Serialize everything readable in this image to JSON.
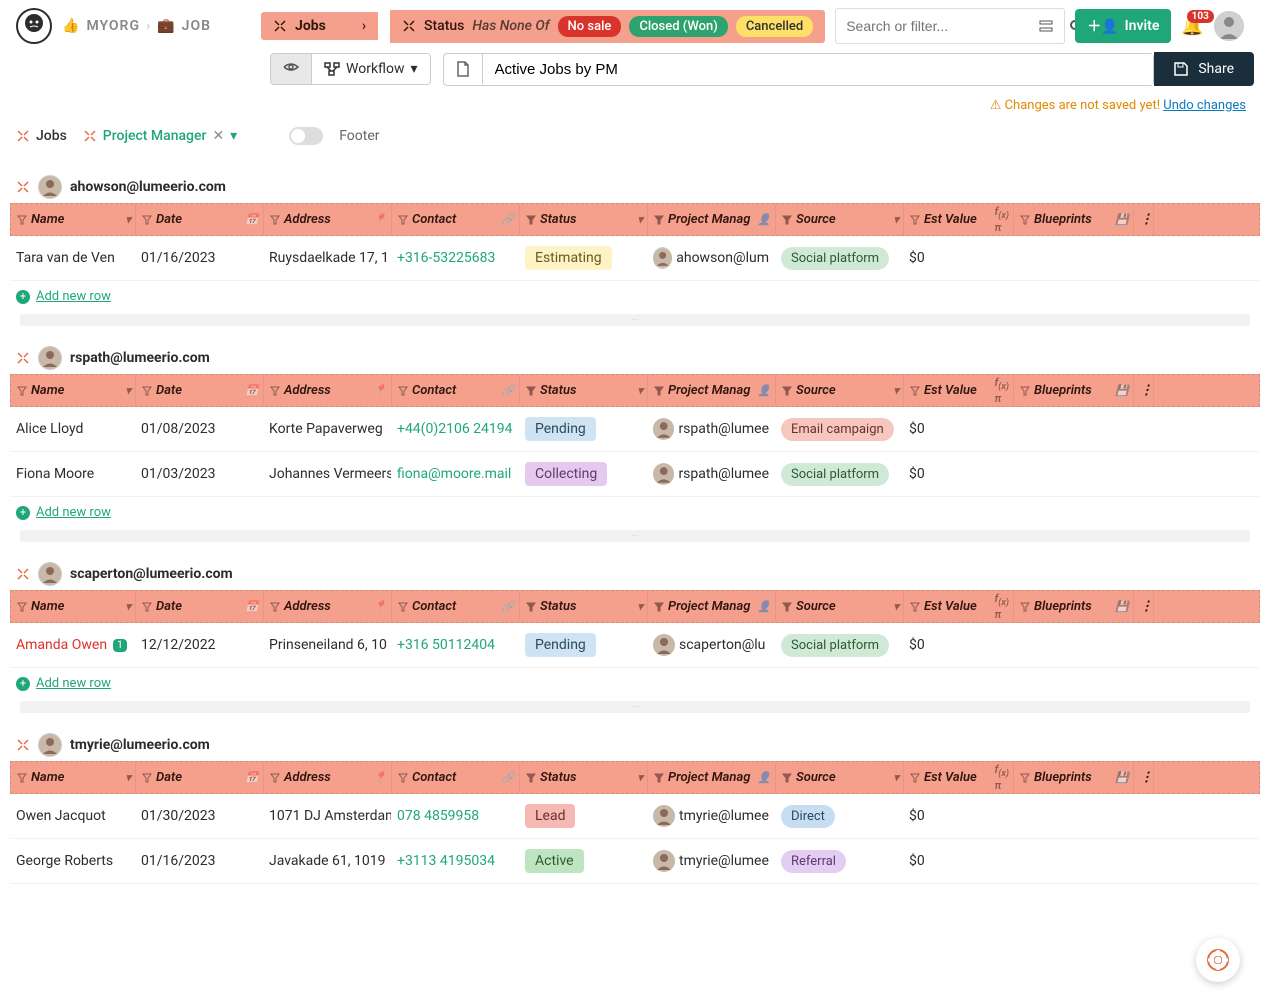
{
  "breadcrumb": {
    "org": "MYORG",
    "item": "JOB"
  },
  "filter": {
    "main": "Jobs",
    "status_label": "Status",
    "predicate": "Has None Of",
    "tags": [
      "No sale",
      "Closed (Won)",
      "Cancelled"
    ]
  },
  "search_placeholder": "Search or filter...",
  "invite_label": "Invite",
  "notif_count": "103",
  "workflow_label": "Workflow",
  "view_title": "Active Jobs by PM",
  "share_label": "Share",
  "unsaved_msg": "Changes are not saved yet!",
  "undo_label": "Undo changes",
  "tabs": {
    "jobs": "Jobs",
    "pm": "Project Manager"
  },
  "footer_label": "Footer",
  "columns": {
    "name": "Name",
    "date": "Date",
    "address": "Address",
    "contact": "Contact",
    "status": "Status",
    "pm": "Project Manag",
    "source": "Source",
    "est": "Est Value",
    "bp": "Blueprints"
  },
  "add_row": "Add new row",
  "status_colors": {
    "Estimating": {
      "bg": "#fdf3c7",
      "fg": "#6b5a17"
    },
    "Pending": {
      "bg": "#cfe3f2",
      "fg": "#2b4a60"
    },
    "Collecting": {
      "bg": "#e6c9ef",
      "fg": "#5e3a6b"
    },
    "Lead": {
      "bg": "#f5b8b3",
      "fg": "#6b302c"
    },
    "Active": {
      "bg": "#bde5c0",
      "fg": "#2d5a32"
    }
  },
  "source_colors": {
    "Social platform": {
      "bg": "#cfe9d6",
      "fg": "#2d5a32"
    },
    "Email campaign": {
      "bg": "#f6c7bf",
      "fg": "#6b302c"
    },
    "Direct": {
      "bg": "#c7ddf2",
      "fg": "#2b4a60"
    },
    "Referral": {
      "bg": "#e3cdf2",
      "fg": "#5e3a6b"
    }
  },
  "groups": [
    {
      "email": "ahowson@lumeerio.com",
      "rows": [
        {
          "name": "Tara van de Ven",
          "date": "01/16/2023",
          "address": "Ruysdaelkade 17, 1",
          "contact": "+316-53225683",
          "status": "Estimating",
          "pm": "ahowson@lum",
          "source": "Social platform",
          "est": "$0"
        }
      ]
    },
    {
      "email": "rspath@lumeerio.com",
      "rows": [
        {
          "name": "Alice Lloyd",
          "date": "01/08/2023",
          "address": "Korte Papaverweg",
          "contact": "+44(0)2106 24194",
          "status": "Pending",
          "pm": "rspath@lumee",
          "source": "Email campaign",
          "est": "$0"
        },
        {
          "name": "Fiona Moore",
          "date": "01/03/2023",
          "address": "Johannes Vermeers",
          "contact": "fiona@moore.mail",
          "status": "Collecting",
          "pm": "rspath@lumee",
          "source": "Social platform",
          "est": "$0"
        }
      ]
    },
    {
      "email": "scaperton@lumeerio.com",
      "rows": [
        {
          "name": "Amanda Owen",
          "name_warn": true,
          "name_badge": "1",
          "date": "12/12/2022",
          "address": "Prinseneiland 6, 10",
          "contact": "+316 50112404",
          "status": "Pending",
          "pm": "scaperton@lu",
          "source": "Social platform",
          "est": "$0"
        }
      ]
    },
    {
      "email": "tmyrie@lumeerio.com",
      "rows": [
        {
          "name": "Owen Jacquot",
          "date": "01/30/2023",
          "address": "1071 DJ Amsterdam",
          "contact": "078 4859958",
          "status": "Lead",
          "pm": "tmyrie@lumee",
          "source": "Direct",
          "est": "$0"
        },
        {
          "name": "George Roberts",
          "date": "01/16/2023",
          "address": "Javakade 61, 1019",
          "contact": "+3113 4195034",
          "status": "Active",
          "pm": "tmyrie@lumee",
          "source": "Referral",
          "est": "$0"
        }
      ]
    }
  ]
}
